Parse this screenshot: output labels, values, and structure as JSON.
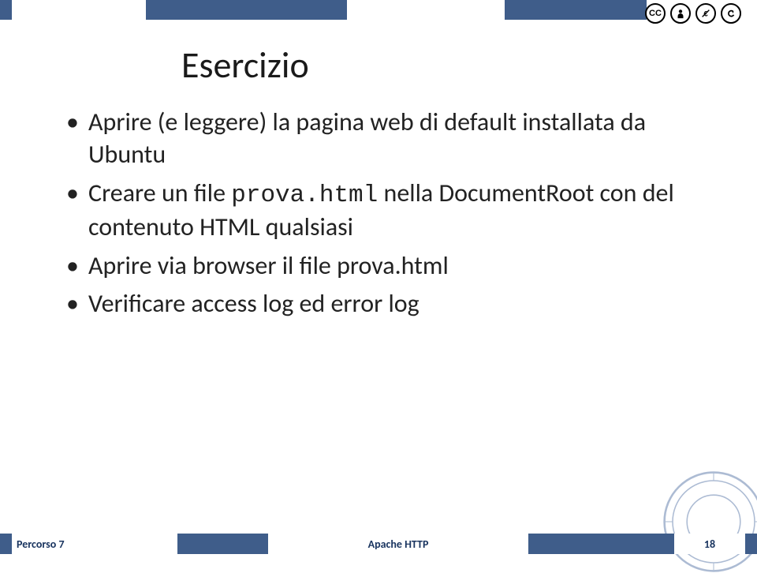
{
  "cc": [
    "CC",
    "person",
    "euro",
    "reverse"
  ],
  "title": "Esercizio",
  "bullets": [
    {
      "pre": "Aprire (e leggere) la pagina web di default installata da Ubuntu",
      "code": "",
      "post": ""
    },
    {
      "pre": "Creare un file ",
      "code": "prova.html",
      "post": " nella DocumentRoot con del contenuto HTML qualsiasi"
    },
    {
      "pre": "Aprire via browser il file prova.html",
      "code": "",
      "post": ""
    },
    {
      "pre": "Verificare access log ed error log",
      "code": "",
      "post": ""
    }
  ],
  "footer": {
    "left": "Percorso 7",
    "center": "Apache HTTP",
    "page": "18"
  }
}
